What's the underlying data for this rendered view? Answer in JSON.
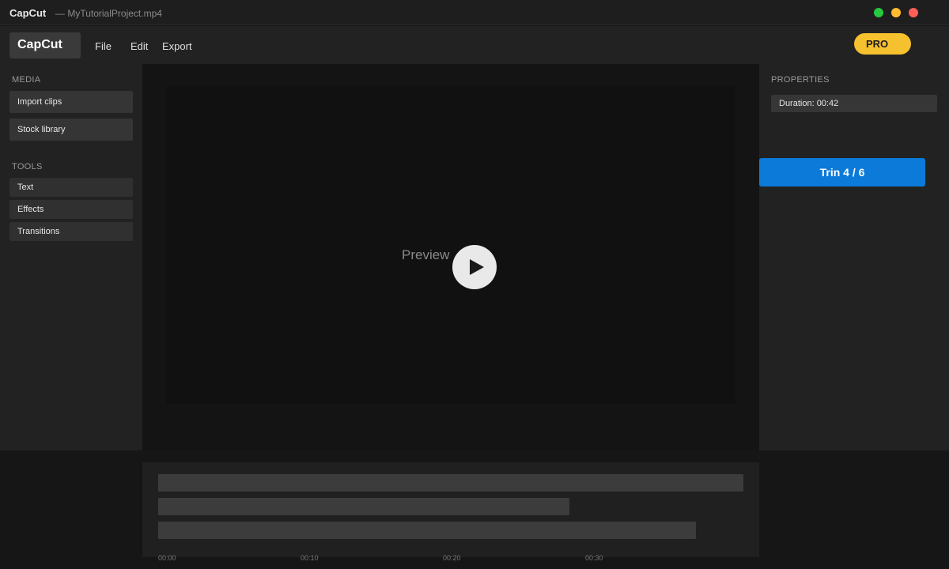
{
  "window": {
    "app_name": "CapCut",
    "file_name": "— MyTutorialProject.mp4",
    "controls": [
      "green",
      "yellow",
      "red"
    ]
  },
  "menubar": {
    "logo": "CapCut",
    "menu": [
      "File",
      "Edit",
      "Export"
    ],
    "pro_label": "PRO"
  },
  "sidebar": {
    "media_title": "MEDIA",
    "media_buttons": [
      "Import clips",
      "Stock library"
    ],
    "tools_title": "TOOLS",
    "tool_buttons": [
      "Text",
      "Effects",
      "Transitions"
    ]
  },
  "preview": {
    "label": "Preview",
    "play_icon": "play-icon"
  },
  "properties": {
    "title": "PROPERTIES",
    "duration": "Duration: 00:42",
    "trim_button": "Trin 4 / 6"
  },
  "timeline": {
    "ticks": [
      "00:00",
      "00:10",
      "00:20",
      "00:30"
    ],
    "track_count": 3
  },
  "colors": {
    "accent": "#0b7ad9",
    "pro": "#f5c12e",
    "traffic_green": "#27c93f",
    "traffic_yellow": "#ffbd2e",
    "traffic_red": "#ff5f57"
  }
}
